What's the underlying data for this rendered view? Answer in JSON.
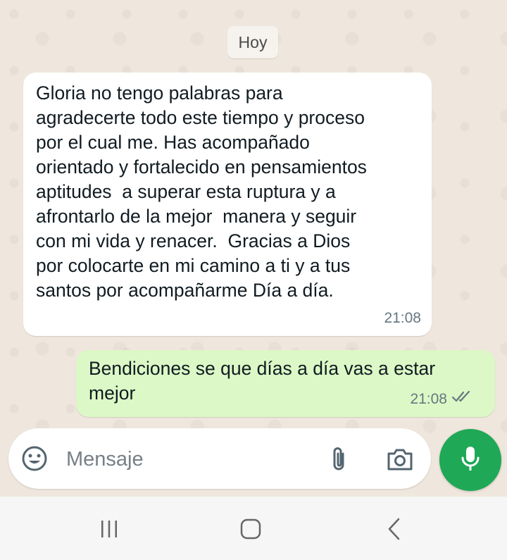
{
  "chat": {
    "date_label": "Hoy",
    "messages": [
      {
        "direction": "incoming",
        "text": "Gloria no tengo palabras para\nagradecerte todo este tiempo y proceso\npor el cual me. Has acompañado\norientado y fortalecido en pensamientos\naptitudes  a superar esta ruptura y a\nafrontarlo de la mejor  manera y seguir\ncon mi vida y renacer.  Gracias a Dios\npor colocarte en mi camino a ti y a tus\nsantos por acompañarme Día a día.",
        "time": "21:08"
      },
      {
        "direction": "outgoing",
        "text": "Bendiciones se que días a día vas a estar\nmejor",
        "time": "21:08",
        "status": "read",
        "status_icon": "double-check-icon"
      }
    ]
  },
  "composer": {
    "placeholder": "Mensaje",
    "value": "",
    "icons": [
      "emoji-icon",
      "paperclip-icon",
      "camera-icon",
      "microphone-icon"
    ]
  },
  "nav_bar": {
    "buttons": [
      "recents-icon",
      "home-icon",
      "back-icon"
    ]
  },
  "colors": {
    "chat_background": "#efe7dd",
    "incoming_bubble": "#ffffff",
    "outgoing_bubble": "#dcf8c6",
    "accent": "#1fa855"
  }
}
